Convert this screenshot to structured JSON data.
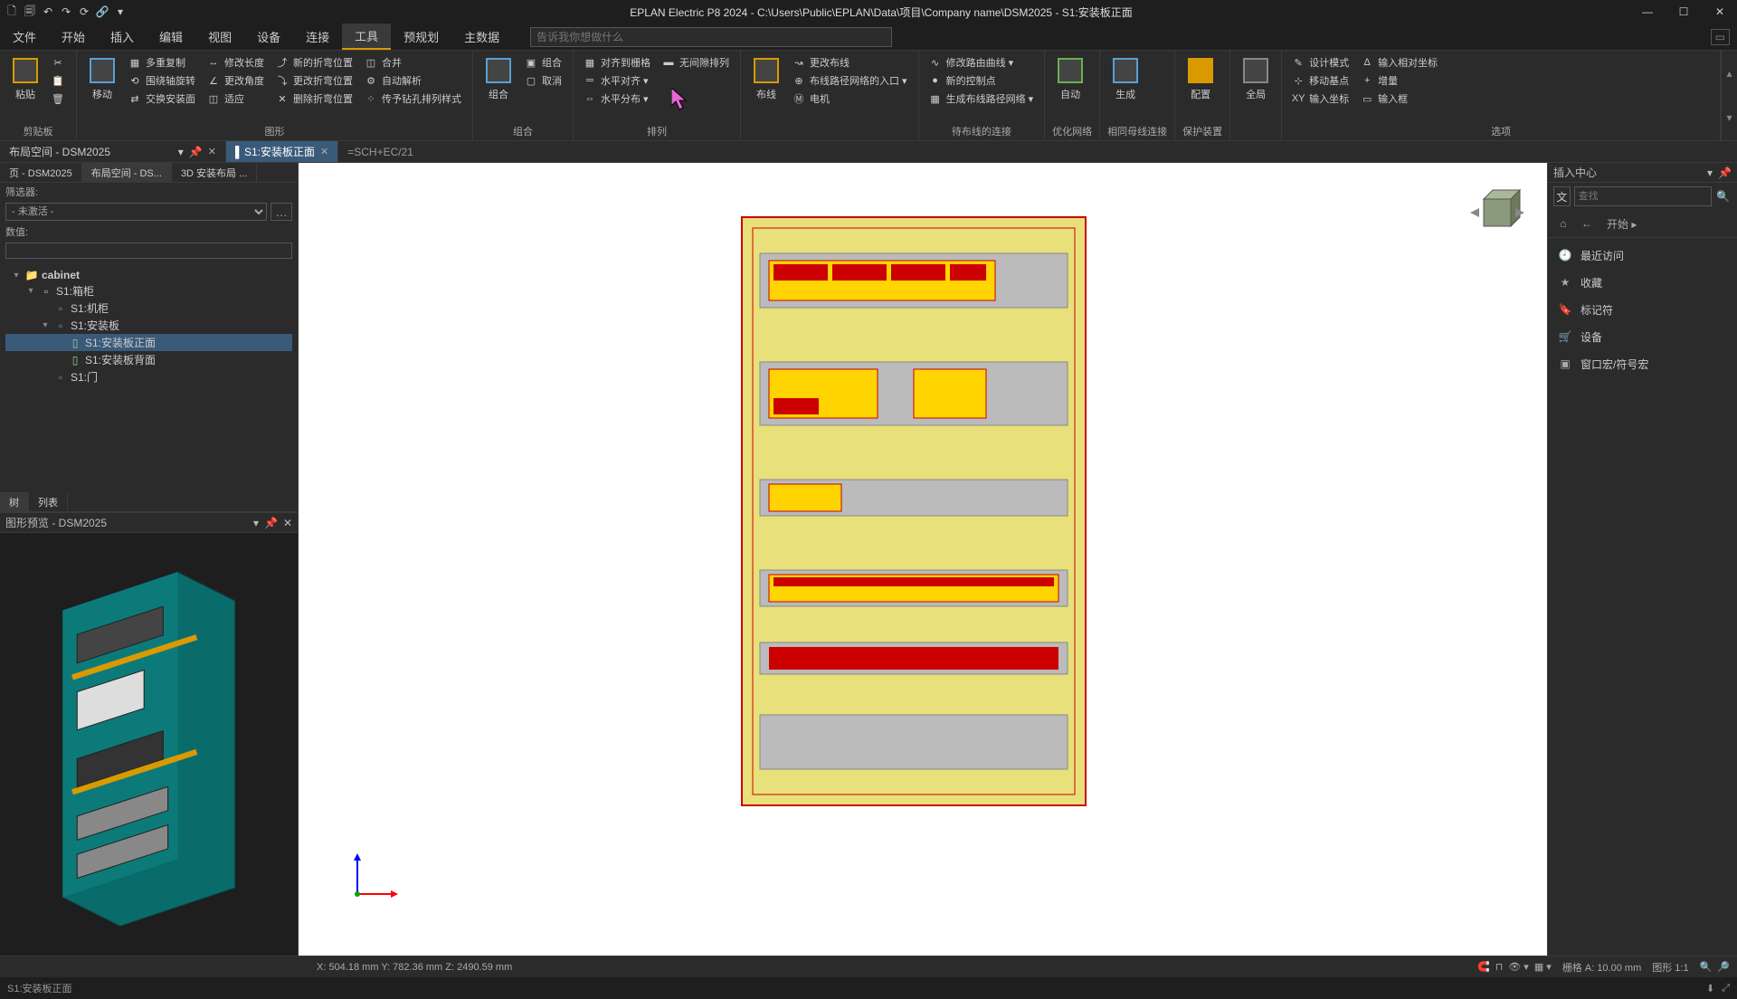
{
  "title": "EPLAN Electric P8 2024 - C:\\Users\\Public\\EPLAN\\Data\\项目\\Company name\\DSM2025 - S1:安装板正面",
  "menu": {
    "items": [
      "文件",
      "开始",
      "插入",
      "编辑",
      "视图",
      "设备",
      "连接",
      "工具",
      "预规划",
      "主数据"
    ],
    "active": "工具",
    "search_placeholder": "告诉我你想做什么"
  },
  "ribbon": {
    "groups": [
      {
        "label": "剪贴板",
        "big": [
          {
            "label": "粘贴"
          }
        ],
        "small_cols": [
          [
            "✂",
            "📋",
            "🗑"
          ]
        ]
      },
      {
        "label": "图形",
        "big": [
          {
            "label": "移动"
          }
        ],
        "small_rows": [
          [
            "多重复制",
            "修改长度",
            "新的折弯位置",
            "合并"
          ],
          [
            "围绕轴旋转",
            "更改角度",
            "更改折弯位置",
            "自动解析"
          ],
          [
            "交换安装面",
            "适应",
            "删除折弯位置",
            "传予钻孔排列样式"
          ]
        ]
      },
      {
        "label": "组合",
        "big": [
          {
            "label": "组合"
          }
        ],
        "small_rows": [
          [
            "组合"
          ],
          [
            "取消"
          ]
        ]
      },
      {
        "label": "排列",
        "small_rows": [
          [
            "对齐到栅格",
            "无间隙排列"
          ],
          [
            "水平对齐 ▾",
            ""
          ],
          [
            "水平分布 ▾",
            ""
          ]
        ]
      },
      {
        "label": "",
        "big": [
          {
            "label": "布线"
          }
        ],
        "small_rows": [
          [
            "更改布线"
          ],
          [
            "布线路径网络的入口 ▾"
          ],
          [
            "电机"
          ]
        ]
      },
      {
        "label": "待布线的连接",
        "small_rows": [
          [
            "修改路由曲线 ▾"
          ],
          [
            "新的控制点"
          ],
          [
            "生成布线路径网络 ▾"
          ]
        ]
      },
      {
        "label": "优化网络",
        "big": [
          {
            "label": "自动"
          }
        ]
      },
      {
        "label": "相同母线连接",
        "big": [
          {
            "label": "生成"
          }
        ]
      },
      {
        "label": "保护装置",
        "big": [
          {
            "label": "配置"
          }
        ]
      },
      {
        "label": "",
        "big": [
          {
            "label": "全局"
          }
        ]
      },
      {
        "label": "选项",
        "small_rows": [
          [
            "设计模式",
            "输入相对坐标"
          ],
          [
            "移动基点",
            "增量"
          ],
          [
            "输入坐标",
            "输入框"
          ]
        ]
      }
    ]
  },
  "doctabs": {
    "left": {
      "label": "布局空间 - DSM2025"
    },
    "tabs": [
      {
        "label": "S1:安装板正面",
        "active": true
      }
    ],
    "path": "=SCH+EC/21"
  },
  "left_panel": {
    "top_tabs": [
      "页 - DSM2025",
      "布局空间 - DS...",
      "3D 安装布局 ..."
    ],
    "filter_label": "筛选器:",
    "filter_value": "- 未激活 -",
    "value_label": "数值:",
    "tree": [
      {
        "indent": 0,
        "toggle": "▾",
        "icon": "cabinet",
        "label": "cabinet",
        "bold": true
      },
      {
        "indent": 1,
        "toggle": "▾",
        "icon": "box",
        "label": "S1:箱柜"
      },
      {
        "indent": 2,
        "toggle": "",
        "icon": "panel",
        "label": "S1:机柜"
      },
      {
        "indent": 2,
        "toggle": "▾",
        "icon": "panel",
        "label": "S1:安装板"
      },
      {
        "indent": 3,
        "toggle": "",
        "icon": "sheet",
        "label": "S1:安装板正面",
        "selected": true
      },
      {
        "indent": 3,
        "toggle": "",
        "icon": "sheet",
        "label": "S1:安装板背面"
      },
      {
        "indent": 2,
        "toggle": "",
        "icon": "door",
        "label": "S1:门"
      }
    ],
    "bottom_tabs": [
      "树",
      "列表"
    ],
    "preview_title": "图形预览 - DSM2025"
  },
  "right_panel": {
    "title": "插入中心",
    "search_placeholder": "查找",
    "nav_current": "开始 ▸",
    "items": [
      {
        "icon": "clock",
        "label": "最近访问"
      },
      {
        "icon": "star",
        "label": "收藏"
      },
      {
        "icon": "tag",
        "label": "标记符"
      },
      {
        "icon": "cart",
        "label": "设备"
      },
      {
        "icon": "window",
        "label": "窗口宏/符号宏"
      }
    ]
  },
  "statusbar": {
    "coords": "X: 504.18 mm Y: 782.36 mm Z: 2490.59 mm",
    "grid": "栅格 A: 10.00 mm",
    "scale": "图形 1:1"
  },
  "bottombar": {
    "left": "S1:安装板正面"
  }
}
